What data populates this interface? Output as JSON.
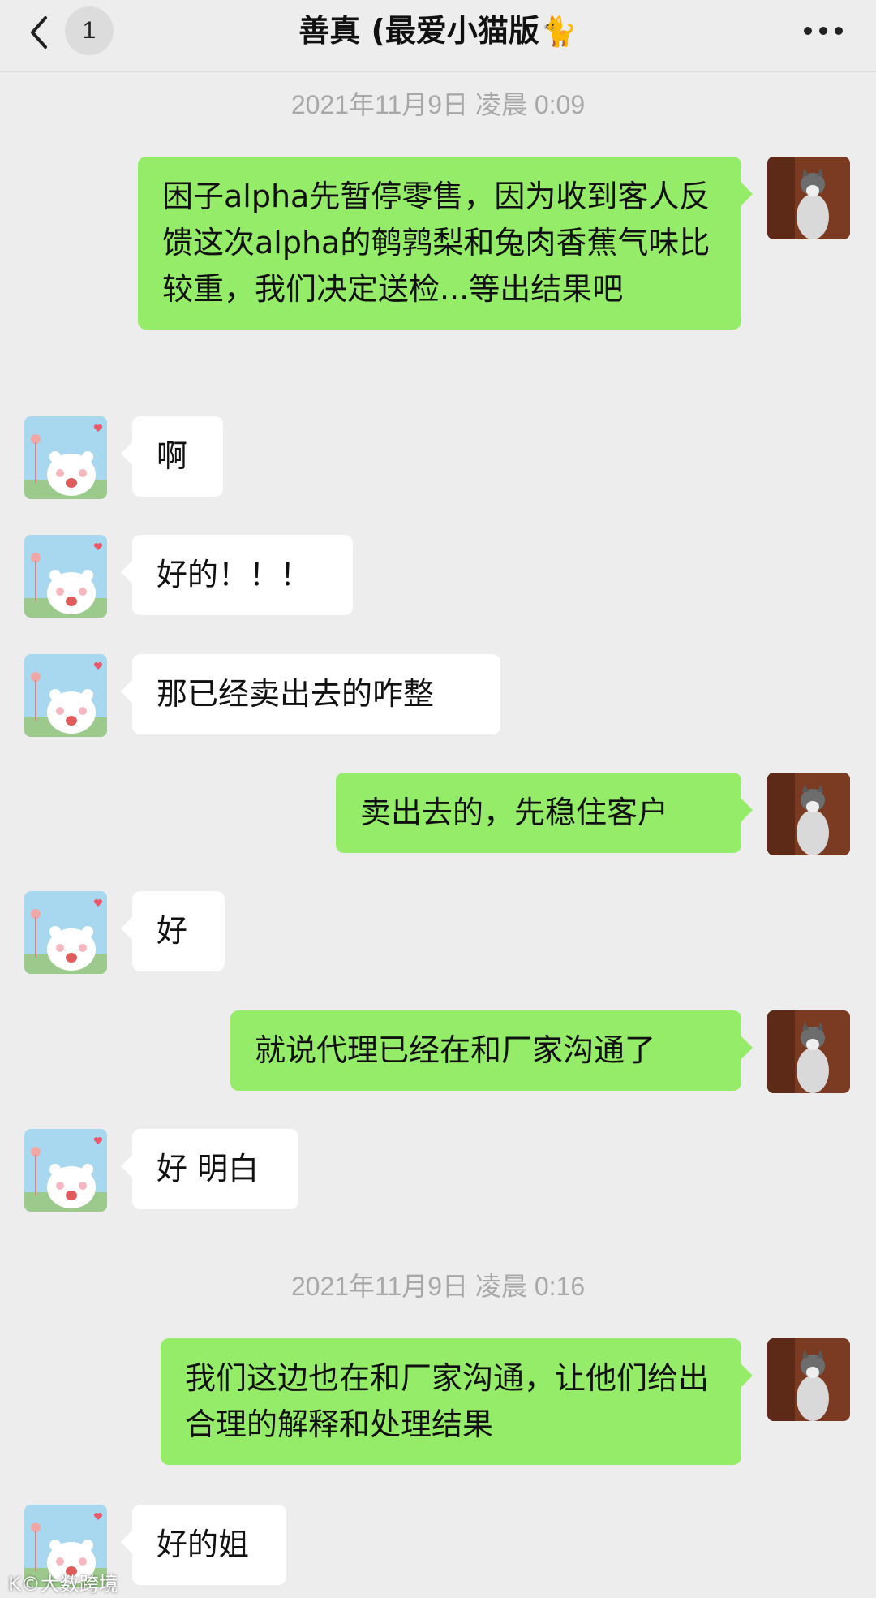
{
  "header": {
    "unread_count": "1",
    "title": "善真 (最爱小猫版",
    "title_emoji": "🐈",
    "back_icon": "chevron-left-icon",
    "more_icon": "more-dots-icon"
  },
  "colors": {
    "background": "#ededed",
    "outgoing_bubble": "#95ec69",
    "incoming_bubble": "#ffffff",
    "timestamp_text": "#a8a8a8"
  },
  "timestamps": [
    "2021年11月9日 凌晨 0:09",
    "2021年11月9日 凌晨 0:16"
  ],
  "messages": [
    {
      "from": "me",
      "text": "困子alpha先暂停零售，因为收到客人反馈这次alpha的鹌鹑梨和兔肉香蕉气味比较重，我们决定送检...等出结果吧"
    },
    {
      "from": "contact",
      "text": "啊"
    },
    {
      "from": "contact",
      "text": "好的！！！"
    },
    {
      "from": "contact",
      "text": "那已经卖出去的咋整"
    },
    {
      "from": "me",
      "text": "卖出去的，先稳住客户"
    },
    {
      "from": "contact",
      "text": "好"
    },
    {
      "from": "me",
      "text": "就说代理已经在和厂家沟通了"
    },
    {
      "from": "contact",
      "text": "好 明白"
    },
    {
      "from": "me",
      "text": "我们这边也在和厂家沟通，让他们给出合理的解释和处理结果"
    },
    {
      "from": "contact",
      "text": "好的姐"
    }
  ],
  "watermark": "K©大数跨境"
}
